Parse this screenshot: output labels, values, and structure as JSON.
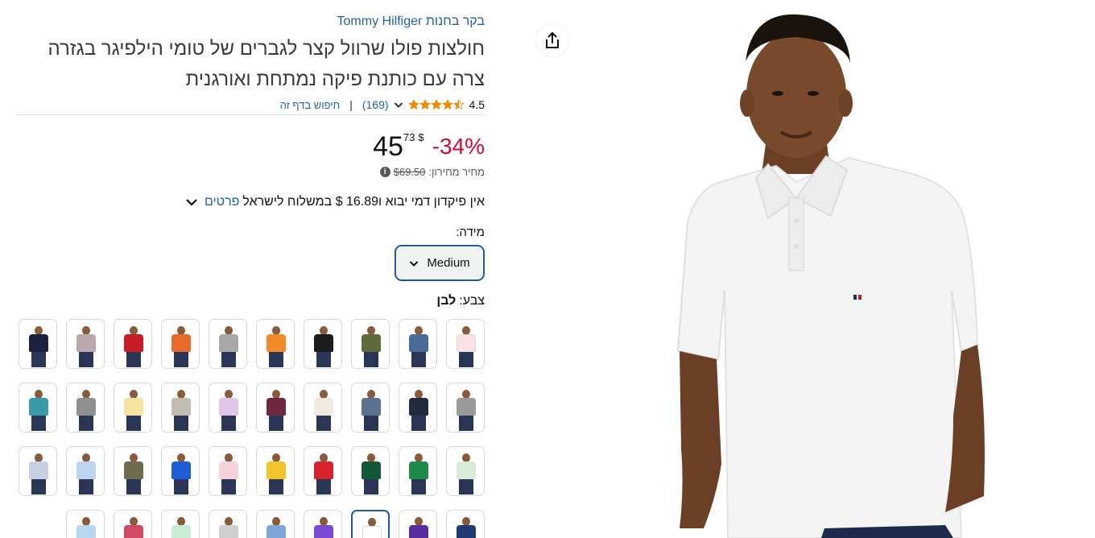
{
  "store": {
    "link_text": "בקר בחנות Tommy Hilfiger"
  },
  "product": {
    "title": "חולצות פולו שרוול קצר לגברים של טומי הילפיגר בגזרה צרה עם כותנת פיקה נמתחת ואורגנית",
    "rating_value": "4.5",
    "rating_stars": 4.5,
    "rating_count": "(169)",
    "search_page_link": "חיפוש בדף זה",
    "separator": "|"
  },
  "price": {
    "discount": "-34%",
    "currency": "$",
    "whole": "45",
    "fraction": "73",
    "list_price_label": "מחיר מחירון:",
    "list_price_value": "$69.50",
    "info_icon": "i"
  },
  "shipping": {
    "text": "אין פיקדון דמי יבוא ו16.89 $ במשלוח לישראל",
    "details_link": "פרטים"
  },
  "size": {
    "label": "מידה:",
    "selected": "Medium"
  },
  "color": {
    "label": "צבע:",
    "selected": "לבן"
  },
  "swatch_rows": [
    [
      {
        "name": "light-pink",
        "color": "#f7e3e6"
      },
      {
        "name": "navy-blue-denim",
        "color": "#4a6a9a"
      },
      {
        "name": "olive",
        "color": "#5e6a3a"
      },
      {
        "name": "black",
        "color": "#1c1c1c"
      },
      {
        "name": "orange",
        "color": "#f28a2a"
      },
      {
        "name": "grey-heather",
        "color": "#a8a8a8"
      },
      {
        "name": "multi-print",
        "color": "#e86a2a"
      },
      {
        "name": "red",
        "color": "#c81d25"
      },
      {
        "name": "grey-tipped",
        "color": "#b8a9ad"
      },
      {
        "name": "navy",
        "color": "#1b2240"
      }
    ],
    [
      {
        "name": "grey-contrast",
        "color": "#9a9a9a"
      },
      {
        "name": "dark-navy",
        "color": "#232a3e"
      },
      {
        "name": "steel-blue",
        "color": "#5b7190"
      },
      {
        "name": "ivory",
        "color": "#efe9df"
      },
      {
        "name": "burgundy",
        "color": "#6e2840"
      },
      {
        "name": "lavender",
        "color": "#e2c6ea"
      },
      {
        "name": "stone",
        "color": "#c2bdb2"
      },
      {
        "name": "butter-yellow",
        "color": "#f6e3a0"
      },
      {
        "name": "medium-grey",
        "color": "#8f8f8f"
      },
      {
        "name": "teal",
        "color": "#3a9aa6"
      }
    ],
    [
      {
        "name": "mint",
        "color": "#d6ecd9"
      },
      {
        "name": "green",
        "color": "#1f8a4c"
      },
      {
        "name": "forest-green",
        "color": "#14563a"
      },
      {
        "name": "bright-red",
        "color": "#d8232f"
      },
      {
        "name": "yellow",
        "color": "#f2c52a"
      },
      {
        "name": "baby-pink",
        "color": "#f4d2dc"
      },
      {
        "name": "royal-blue",
        "color": "#1e5bd6"
      },
      {
        "name": "khaki-olive",
        "color": "#6d6c4e"
      },
      {
        "name": "sky-blue",
        "color": "#bcd4f0"
      },
      {
        "name": "light-grey-blue",
        "color": "#c7cfe0"
      }
    ],
    [
      {
        "name": "dark-blue",
        "color": "#1d3b70"
      },
      {
        "name": "purple-print",
        "color": "#5a2ca0"
      },
      {
        "name": "white",
        "color": "#ffffff"
      },
      {
        "name": "violet-print",
        "color": "#7a4ad0"
      },
      {
        "name": "cornflower",
        "color": "#7fa6d9"
      },
      {
        "name": "light-grey-print",
        "color": "#cfcfcf"
      },
      {
        "name": "seafoam",
        "color": "#c6ecd4"
      },
      {
        "name": "raspberry",
        "color": "#d04a66"
      },
      {
        "name": "pale-blue",
        "color": "#b9d6ef"
      }
    ]
  ],
  "selected_swatch": "white",
  "icons": {
    "share": "share-icon",
    "star": "star-icon",
    "chevron": "chevron-down-icon",
    "info": "info-icon"
  },
  "colors": {
    "link": "#2162a1",
    "discount": "#cc0c39",
    "star": "#f08a00",
    "focus_border": "#1c5aa8"
  }
}
